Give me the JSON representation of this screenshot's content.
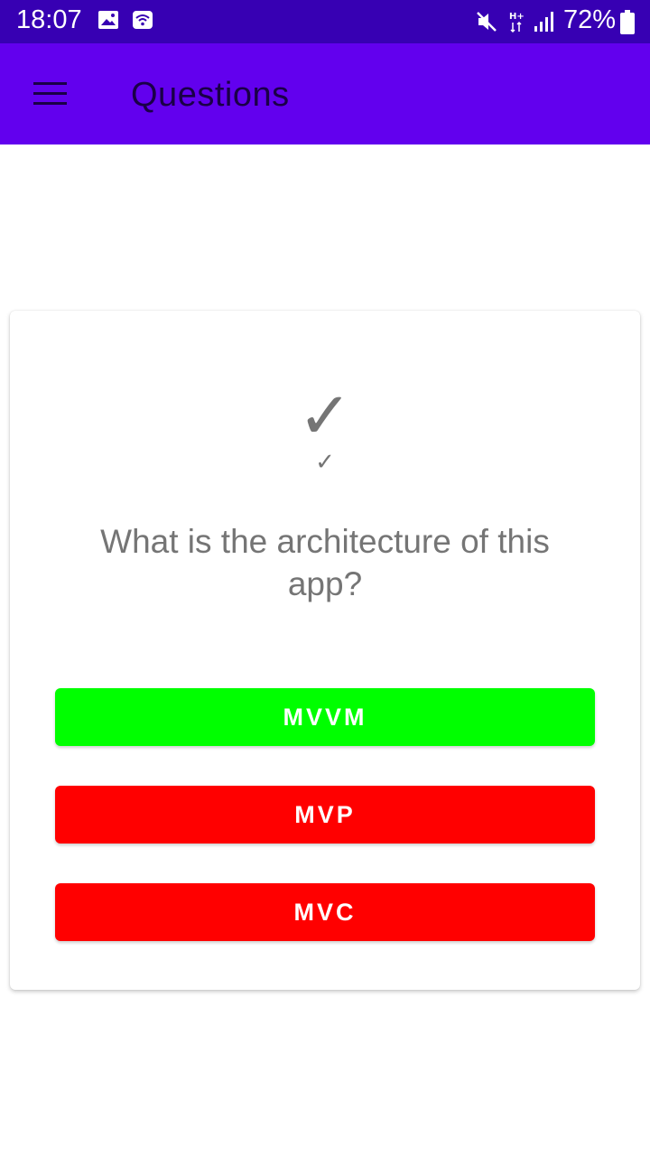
{
  "status_bar": {
    "time": "18:07",
    "battery_percent": "72%",
    "icons": [
      "image-icon",
      "wifi-hotspot-icon",
      "mute-icon",
      "hplus-data-icon",
      "signal-icon",
      "battery-icon"
    ]
  },
  "app_bar": {
    "title": "Questions",
    "menu_icon": "menu-icon"
  },
  "question_card": {
    "check_large": "✓",
    "check_small": "✓",
    "question_text": "What is the architecture of this app?",
    "answers": [
      {
        "label": "MVVM",
        "color": "#00ff00"
      },
      {
        "label": "MVP",
        "color": "#ff0000"
      },
      {
        "label": "MVC",
        "color": "#ff0000"
      }
    ]
  },
  "colors": {
    "status_bar": "#3700b3",
    "app_bar": "#6200ee",
    "correct": "#00ff00",
    "incorrect": "#ff0000"
  }
}
